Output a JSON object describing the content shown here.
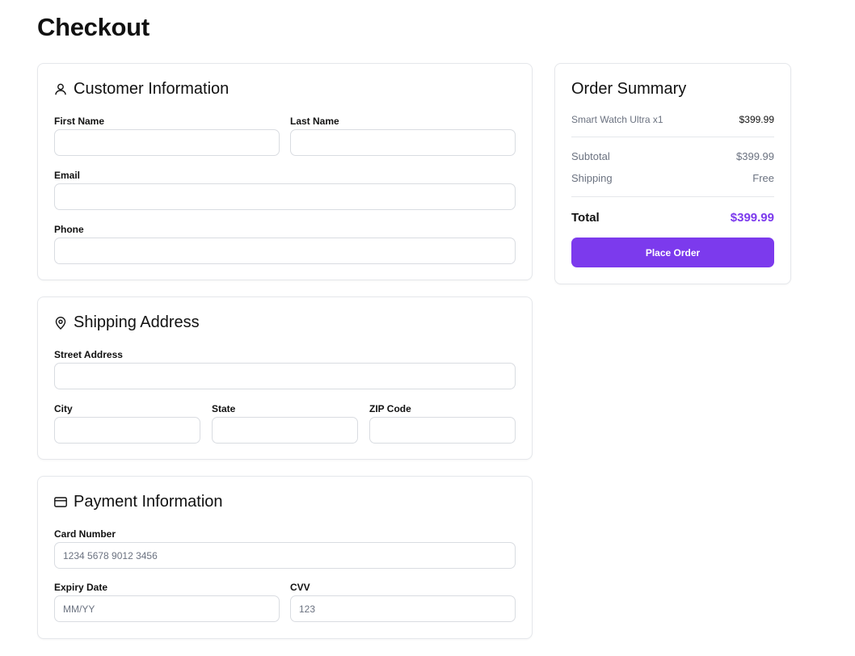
{
  "page": {
    "title": "Checkout"
  },
  "customer": {
    "title": "Customer Information",
    "icon": "user-icon",
    "first_name_label": "First Name",
    "last_name_label": "Last Name",
    "email_label": "Email",
    "phone_label": "Phone"
  },
  "shipping": {
    "title": "Shipping Address",
    "icon": "map-pin-icon",
    "street_label": "Street Address",
    "city_label": "City",
    "state_label": "State",
    "zip_label": "ZIP Code"
  },
  "payment": {
    "title": "Payment Information",
    "icon": "credit-card-icon",
    "card_number_label": "Card Number",
    "card_number_placeholder": "1234 5678 9012 3456",
    "expiry_label": "Expiry Date",
    "expiry_placeholder": "MM/YY",
    "cvv_label": "CVV",
    "cvv_placeholder": "123"
  },
  "summary": {
    "title": "Order Summary",
    "item_name": "Smart Watch Ultra x1",
    "item_price": "$399.99",
    "subtotal_label": "Subtotal",
    "subtotal_value": "$399.99",
    "shipping_label": "Shipping",
    "shipping_value": "Free",
    "total_label": "Total",
    "total_value": "$399.99",
    "place_order_label": "Place Order"
  },
  "colors": {
    "accent": "#7c3aed",
    "border": "#e5e7eb",
    "muted_text": "#6b7280"
  }
}
